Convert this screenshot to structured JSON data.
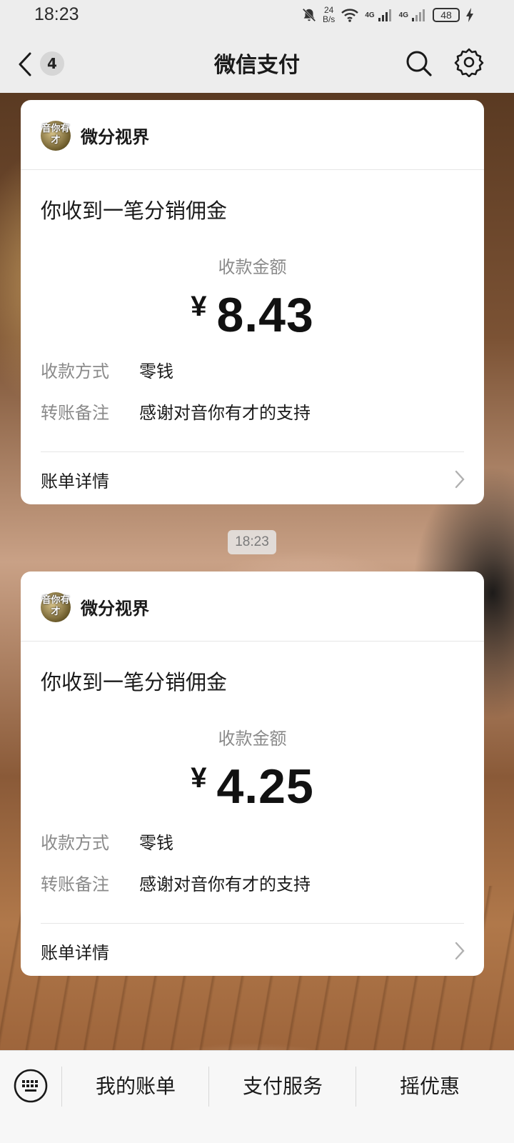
{
  "status_bar": {
    "time": "18:23",
    "speed_value": "24",
    "speed_unit": "B/s",
    "network_1": "4G",
    "network_2": "4G",
    "battery": "48"
  },
  "nav": {
    "unread_count": "4",
    "title": "微信支付"
  },
  "messages": [
    {
      "source_avatar_text": "音你有才",
      "source_name": "微分视界",
      "title": "你收到一笔分销佣金",
      "amount_label": "收款金额",
      "currency": "¥",
      "amount": "8.43",
      "method_label": "收款方式",
      "method_value": "零钱",
      "remark_label": "转账备注",
      "remark_value": "感谢对音你有才的支持",
      "detail_label": "账单详情"
    },
    {
      "source_avatar_text": "音你有才",
      "source_name": "微分视界",
      "title": "你收到一笔分销佣金",
      "amount_label": "收款金额",
      "currency": "¥",
      "amount": "4.25",
      "method_label": "收款方式",
      "method_value": "零钱",
      "remark_label": "转账备注",
      "remark_value": "感谢对音你有才的支持",
      "detail_label": "账单详情"
    }
  ],
  "timestamp": "18:23",
  "bottom_menu": {
    "items": [
      "我的账单",
      "支付服务",
      "摇优惠"
    ]
  },
  "icons": {
    "back": "chevron-left-icon",
    "search": "search-icon",
    "settings": "gear-icon",
    "keyboard": "keyboard-icon",
    "detail_arrow": "chevron-right-icon"
  }
}
